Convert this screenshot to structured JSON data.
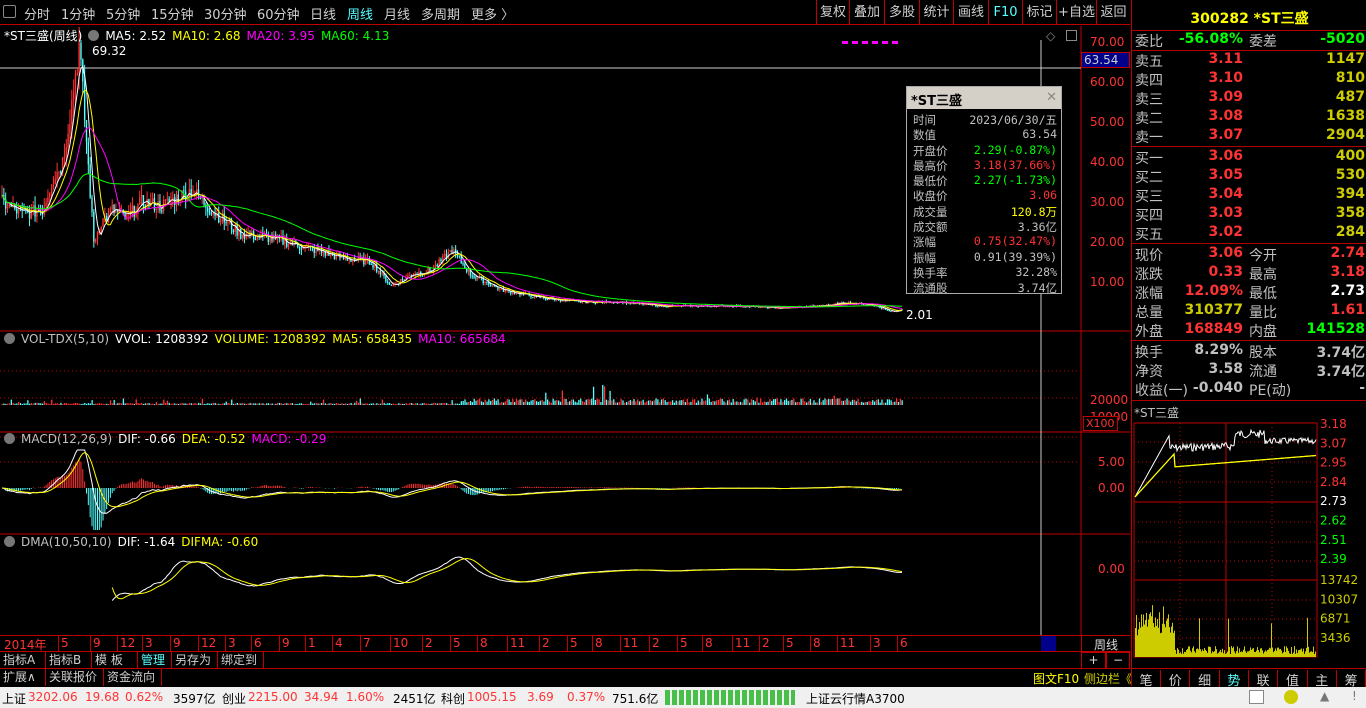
{
  "toolbar": {
    "periods": [
      "分时",
      "1分钟",
      "5分钟",
      "15分钟",
      "30分钟",
      "60分钟",
      "日线",
      "周线",
      "月线",
      "多周期",
      "更多 〉"
    ],
    "active": "周线",
    "right": [
      "复权",
      "叠加",
      "多股",
      "统计",
      "画线",
      "F10",
      "标记",
      "+自选",
      "返回"
    ]
  },
  "main": {
    "title": "*ST三盛(周线)",
    "ma5": "MA5: 2.52",
    "ma10": "MA10: 2.68",
    "ma20": "MA20: 3.95",
    "ma60": "MA60: 4.13",
    "high_label": "69.32",
    "low_label": "2.01",
    "cursor_value": "63.54",
    "price_ticks": [
      "70.00",
      "60.00",
      "50.00",
      "40.00",
      "30.00",
      "20.00",
      "10.00"
    ]
  },
  "vol": {
    "title": "VOL-TDX(5,10)",
    "vvol": "VVOL: 1208392",
    "volume": "VOLUME: 1208392",
    "ma5": "MA5: 658435",
    "ma10": "MA10: 665684",
    "ticks": [
      "20000",
      "10000"
    ],
    "unit": "X100"
  },
  "macd": {
    "title": "MACD(12,26,9)",
    "dif": "DIF: -0.66",
    "dea": "DEA: -0.52",
    "macd": "MACD: -0.29",
    "ticks": [
      "5.00",
      "0.00"
    ]
  },
  "dma": {
    "title": "DMA(10,50,10)",
    "dif": "DIF: -1.64",
    "difma": "DIFMA: -0.60",
    "ticks": [
      "0.00"
    ]
  },
  "date_axis": [
    "2014年",
    "5",
    "9",
    "12",
    "3",
    "9",
    "12",
    "3",
    "6",
    "9",
    "1",
    "4",
    "7",
    "10",
    "2",
    "5",
    "8",
    "11",
    "2",
    "5",
    "8",
    "11",
    "2",
    "5",
    "8",
    "11",
    "2",
    "5",
    "8",
    "11",
    "3",
    "6"
  ],
  "tooltip": {
    "title": "*ST三盛",
    "rows": [
      {
        "k": "时间",
        "v": "2023/06/30/五",
        "c": "#c0c0c0"
      },
      {
        "k": "数值",
        "v": "63.54",
        "c": "#c0c0c0"
      },
      {
        "k": "开盘价",
        "v": "2.29(-0.87%)",
        "c": "#0f0"
      },
      {
        "k": "最高价",
        "v": "3.18(37.66%)",
        "c": "#f33"
      },
      {
        "k": "最低价",
        "v": "2.27(-1.73%)",
        "c": "#0f0"
      },
      {
        "k": "收盘价",
        "v": "3.06",
        "c": "#f33"
      },
      {
        "k": "成交量",
        "v": "120.8万",
        "c": "#ff0"
      },
      {
        "k": "成交额",
        "v": "3.36亿",
        "c": "#c0c0c0"
      },
      {
        "k": "涨幅",
        "v": "0.75(32.47%)",
        "c": "#f33"
      },
      {
        "k": "振幅",
        "v": "0.91(39.39%)",
        "c": "#c0c0c0"
      },
      {
        "k": "换手率",
        "v": "32.28%",
        "c": "#c0c0c0"
      },
      {
        "k": "流通股",
        "v": "3.74亿",
        "c": "#c0c0c0"
      }
    ]
  },
  "quote": {
    "title": "300282 *ST三盛",
    "weibi_label": "委比",
    "weibi": "-56.08%",
    "weicha_label": "委差",
    "weicha": "-5020",
    "sell": [
      {
        "l": "卖五",
        "p": "3.11",
        "v": "1147"
      },
      {
        "l": "卖四",
        "p": "3.10",
        "v": "810"
      },
      {
        "l": "卖三",
        "p": "3.09",
        "v": "487"
      },
      {
        "l": "卖二",
        "p": "3.08",
        "v": "1638"
      },
      {
        "l": "卖一",
        "p": "3.07",
        "v": "2904"
      }
    ],
    "buy": [
      {
        "l": "买一",
        "p": "3.06",
        "v": "400"
      },
      {
        "l": "买二",
        "p": "3.05",
        "v": "530"
      },
      {
        "l": "买三",
        "p": "3.04",
        "v": "394"
      },
      {
        "l": "买四",
        "p": "3.03",
        "v": "358"
      },
      {
        "l": "买五",
        "p": "3.02",
        "v": "284"
      }
    ],
    "stats": [
      {
        "l": "现价",
        "v": "3.06",
        "c": "#f33",
        "l2": "今开",
        "v2": "2.74",
        "c2": "#f33"
      },
      {
        "l": "涨跌",
        "v": "0.33",
        "c": "#f33",
        "l2": "最高",
        "v2": "3.18",
        "c2": "#f33"
      },
      {
        "l": "涨幅",
        "v": "12.09%",
        "c": "#f33",
        "l2": "最低",
        "v2": "2.73",
        "c2": "#fff"
      },
      {
        "l": "总量",
        "v": "310377",
        "c": "#cc0",
        "l2": "量比",
        "v2": "1.61",
        "c2": "#f33"
      },
      {
        "l": "外盘",
        "v": "168849",
        "c": "#f33",
        "l2": "内盘",
        "v2": "141528",
        "c2": "#0f0"
      }
    ],
    "stats2": [
      {
        "l": "换手",
        "v": "8.29%",
        "l2": "股本",
        "v2": "3.74亿"
      },
      {
        "l": "净资",
        "v": "3.58",
        "l2": "流通",
        "v2": "3.74亿"
      },
      {
        "l": "收益(一)",
        "v": "-0.040",
        "l2": "PE(动)",
        "v2": "-"
      }
    ]
  },
  "intraday": {
    "title": "*ST三盛",
    "price_ticks": [
      "3.18",
      "3.07",
      "2.95",
      "2.84",
      "2.73",
      "2.62",
      "2.51",
      "2.39"
    ],
    "vol_ticks": [
      "13742",
      "10307",
      "6871",
      "3436"
    ]
  },
  "side_tabs": [
    "笔",
    "价",
    "细",
    "势",
    "联",
    "值",
    "主",
    "筹"
  ],
  "side_active": "势",
  "period_button": "周线",
  "plus": "+",
  "minus": "−",
  "bottom_tabs": [
    "指标A",
    "指标B",
    "模 板",
    "管理",
    "另存为",
    "绑定到"
  ],
  "bottom_active": "管理",
  "bottom_tabs2": [
    "扩展∧",
    "关联报价",
    "资金流向"
  ],
  "f10_label": "图文F10",
  "sidebar_label": "侧边栏《",
  "status": {
    "sh_label": "上证",
    "sh": "3202.06",
    "sh_chg": "19.68",
    "sh_pct": "0.62%",
    "sh_amt": "3597亿",
    "cy_label": "创业",
    "cy": "2215.00",
    "cy_chg": "34.94",
    "cy_pct": "1.60%",
    "cy_amt": "2451亿",
    "kc_label": "科创",
    "kc": "1005.15",
    "kc_chg": "3.69",
    "kc_pct": "0.37%",
    "kc_amt": "751.6亿",
    "feed": "上证云行情A3700"
  },
  "chart_data": {
    "type": "candlestick",
    "title": "*ST三盛(周线)",
    "x_unit": "week index",
    "y_unit": "price",
    "ylim": [
      0,
      75
    ],
    "close_outline": [
      [
        0,
        30
      ],
      [
        11,
        27
      ],
      [
        22,
        28
      ],
      [
        27,
        35
      ],
      [
        33,
        40
      ],
      [
        38,
        55
      ],
      [
        42,
        69
      ],
      [
        46,
        45
      ],
      [
        50,
        20
      ],
      [
        54,
        25
      ],
      [
        60,
        28
      ],
      [
        68,
        26
      ],
      [
        76,
        30
      ],
      [
        87,
        29
      ],
      [
        103,
        33
      ],
      [
        114,
        28
      ],
      [
        130,
        22
      ],
      [
        146,
        21
      ],
      [
        163,
        19
      ],
      [
        185,
        16
      ],
      [
        201,
        15
      ],
      [
        212,
        9
      ],
      [
        223,
        12
      ],
      [
        234,
        13
      ],
      [
        245,
        18
      ],
      [
        255,
        12
      ],
      [
        272,
        8
      ],
      [
        294,
        6
      ],
      [
        315,
        5
      ],
      [
        337,
        5
      ],
      [
        359,
        4
      ],
      [
        380,
        4
      ],
      [
        402,
        4
      ],
      [
        424,
        3.5
      ],
      [
        446,
        4
      ],
      [
        457,
        4.8
      ],
      [
        473,
        4.5
      ],
      [
        484,
        2.5
      ],
      [
        490,
        3.06
      ]
    ]
  }
}
